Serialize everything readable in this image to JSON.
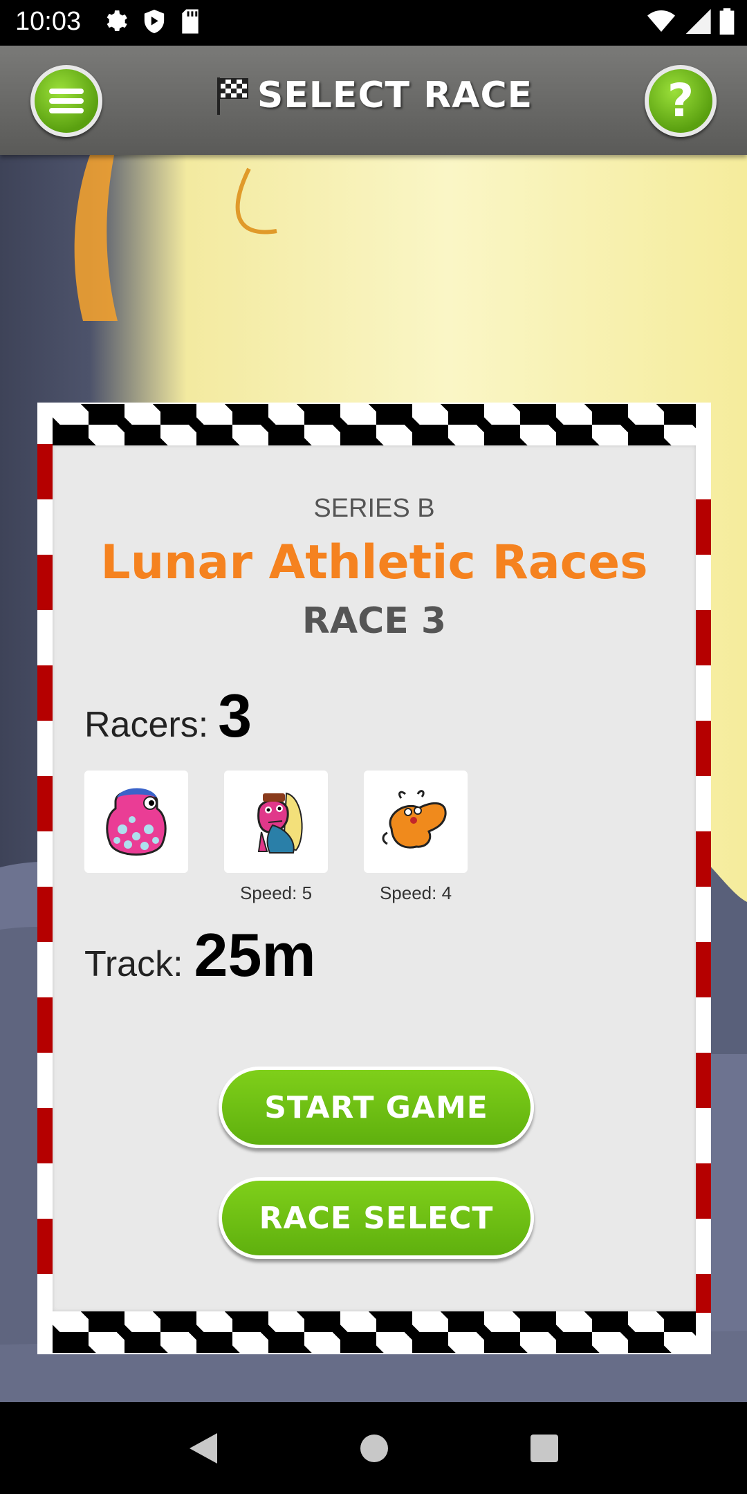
{
  "status_bar": {
    "time": "10:03",
    "icons": [
      "gear-icon",
      "shield-icon",
      "sd-card-icon",
      "wifi-icon",
      "signal-icon",
      "battery-icon"
    ]
  },
  "app_bar": {
    "title": "SELECT RACE",
    "menu_icon": "menu-icon",
    "help_icon": "help-icon",
    "help_glyph": "?"
  },
  "race_card": {
    "series": "SERIES B",
    "race_name": "Lunar Athletic Races",
    "race_number": "RACE 3",
    "racers_label": "Racers:",
    "racers_count": "3",
    "racers": [
      {
        "icon": "pink-spotted-monster",
        "speed": ""
      },
      {
        "icon": "pink-caped-monster",
        "speed": "Speed: 5"
      },
      {
        "icon": "orange-antennae-monster",
        "speed": "Speed: 4"
      }
    ],
    "track_label": "Track:",
    "track_value": "25m",
    "start_button": "START GAME",
    "select_button": "RACE SELECT"
  },
  "colors": {
    "accent_orange": "#f5821f",
    "button_green": "#6cc014",
    "stripe_red": "#b50000"
  },
  "nav_bar": {
    "icons": [
      "back-icon",
      "home-icon",
      "recents-icon"
    ]
  }
}
